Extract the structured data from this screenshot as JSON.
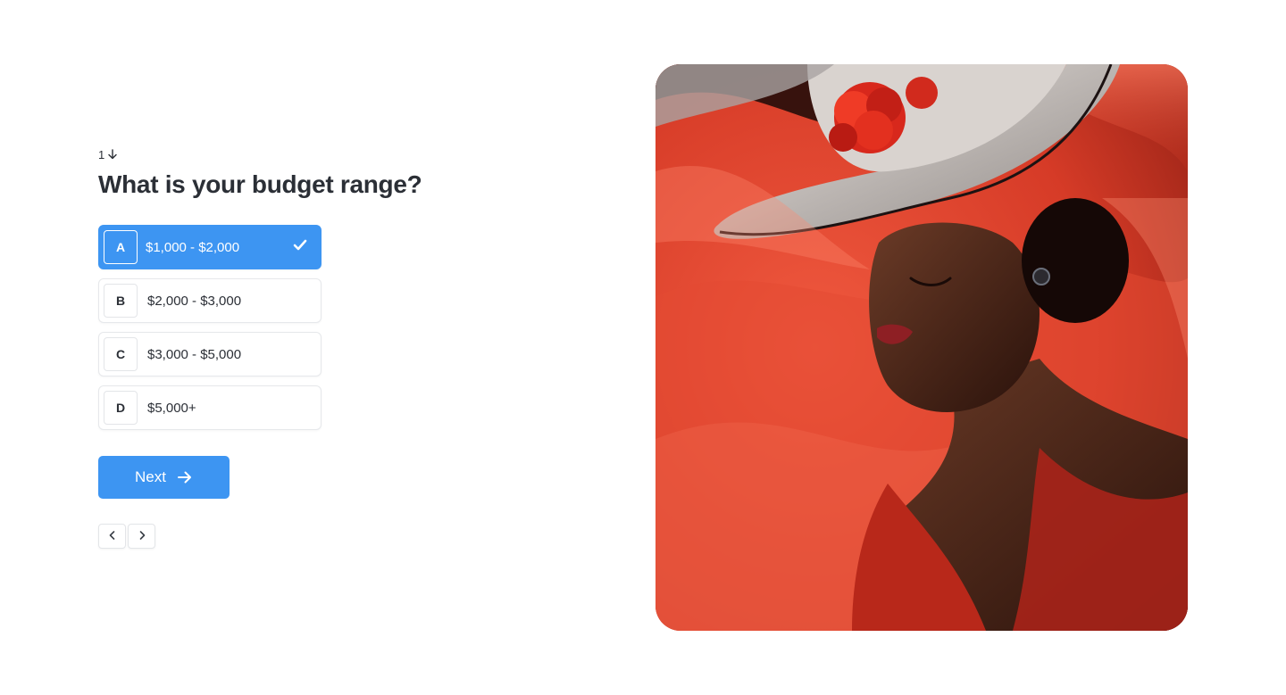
{
  "question": {
    "number": "1",
    "title": "What is your budget range?"
  },
  "options": [
    {
      "key": "A",
      "label": "$1,000 - $2,000",
      "selected": true
    },
    {
      "key": "B",
      "label": "$2,000 - $3,000",
      "selected": false
    },
    {
      "key": "C",
      "label": "$3,000 - $5,000",
      "selected": false
    },
    {
      "key": "D",
      "label": "$5,000+",
      "selected": false
    }
  ],
  "next_button": {
    "label": "Next"
  },
  "colors": {
    "accent": "#3d95f2",
    "text": "#2b2f36",
    "border": "#e6e8eb"
  },
  "icons": {
    "question_number": "arrow-down-icon",
    "selected_option": "check-icon",
    "next": "arrow-right-icon",
    "pager_prev": "chevron-left-icon",
    "pager_next": "chevron-right-icon"
  }
}
